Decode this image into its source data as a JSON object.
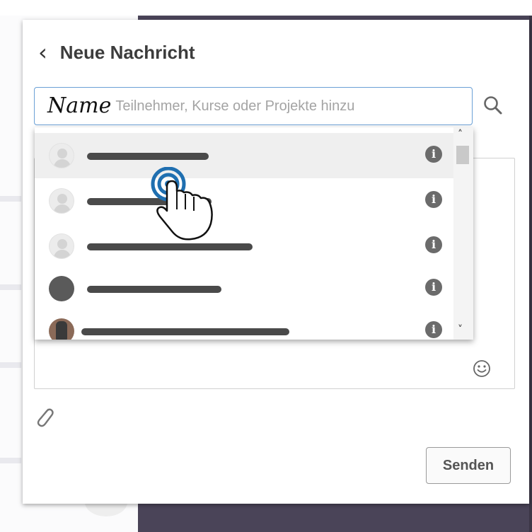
{
  "dialog": {
    "title": "Neue Nachricht"
  },
  "recipient_search": {
    "placeholder": "Fügen Sie Teilnehmer, Kurse oder Projekte hinzu",
    "typed_value": "Name"
  },
  "suggestions": [
    {
      "avatar": "default-avatar-icon",
      "name_redacted": true,
      "highlighted": true
    },
    {
      "avatar": "default-avatar-icon",
      "name_redacted": true,
      "highlighted": false
    },
    {
      "avatar": "default-avatar-icon",
      "name_redacted": true,
      "highlighted": false
    },
    {
      "avatar": "photo-avatar",
      "name_redacted": true,
      "highlighted": false
    },
    {
      "avatar": "photo-avatar",
      "name_redacted": true,
      "highlighted": false
    }
  ],
  "actions": {
    "send_label": "Senden"
  },
  "icons": {
    "back": "chevron-left-icon",
    "search": "search-icon",
    "info": "info-icon",
    "emoji": "smiley-icon",
    "attachment": "paperclip-icon",
    "pointer": "tap-hand-icon"
  },
  "colors": {
    "focus_border": "#6aa0d6",
    "backdrop": "#4a4458",
    "tap_ring": "#1f6fb0"
  }
}
